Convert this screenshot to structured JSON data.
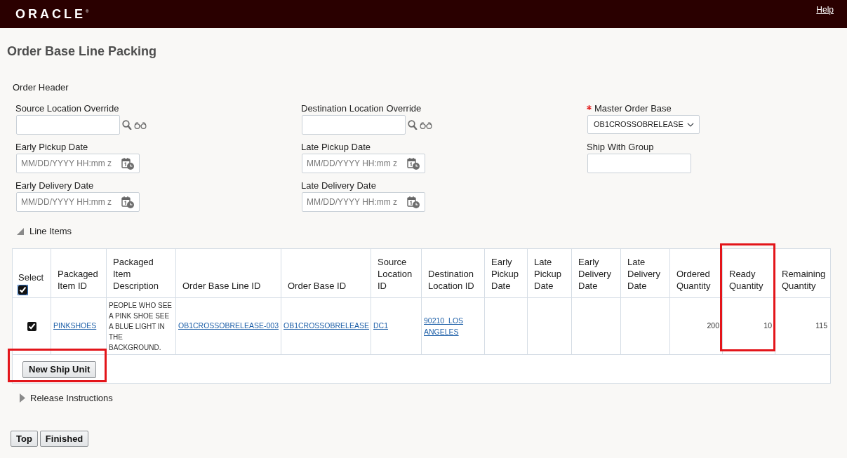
{
  "header": {
    "logo": "ORACLE",
    "logo_mark": "®",
    "help_link": "Help"
  },
  "page_title": "Order Base Line Packing",
  "order_header": {
    "title": "Order Header",
    "columns": [
      {
        "fields": [
          {
            "label": "Source Location Override",
            "kind": "lookup",
            "required": false
          },
          {
            "label": "Early Pickup Date",
            "kind": "date",
            "placeholder": "MM/DD/YYYY HH:mm z",
            "required": false
          },
          {
            "label": "Early Delivery Date",
            "kind": "date",
            "placeholder": "MM/DD/YYYY HH:mm z",
            "required": false
          }
        ]
      },
      {
        "fields": [
          {
            "label": "Destination Location Override",
            "kind": "lookup",
            "required": false
          },
          {
            "label": "Late Pickup Date",
            "kind": "date",
            "placeholder": "MM/DD/YYYY HH:mm z",
            "required": false
          },
          {
            "label": "Late Delivery Date",
            "kind": "date",
            "placeholder": "MM/DD/YYYY HH:mm z",
            "required": false
          }
        ]
      },
      {
        "fields": [
          {
            "label": "Master Order Base",
            "kind": "select",
            "value": "OB1CROSSOBRELEASE",
            "required": true
          },
          {
            "label": "Ship With Group",
            "kind": "text",
            "required": false
          }
        ]
      }
    ]
  },
  "line_items": {
    "title": "Line Items",
    "expanded": true,
    "select_all": {
      "label": "Select",
      "checked": true
    },
    "columns": [
      {
        "label": "Packaged Item ID",
        "highlighted": false
      },
      {
        "label": "Packaged Item Description",
        "highlighted": false
      },
      {
        "label": "Order Base Line ID",
        "highlighted": false
      },
      {
        "label": "Order Base ID",
        "highlighted": false
      },
      {
        "label": "Source Location ID",
        "highlighted": false
      },
      {
        "label": "Destination Location ID",
        "highlighted": false
      },
      {
        "label": "Early Pickup Date",
        "highlighted": false
      },
      {
        "label": "Late Pickup Date",
        "highlighted": false
      },
      {
        "label": "Early Delivery Date",
        "highlighted": false
      },
      {
        "label": "Late Delivery Date",
        "highlighted": false
      },
      {
        "label": "Ordered Quantity",
        "highlighted": false
      },
      {
        "label": "Ready Quantity",
        "highlighted": true
      },
      {
        "label": "Remaining Quantity",
        "highlighted": false
      }
    ],
    "rows": [
      {
        "selected": true,
        "cells": [
          {
            "kind": "link",
            "text": "PINKSHOES"
          },
          {
            "kind": "text",
            "text": "PEOPLE WHO SEE A PINK SHOE SEE A BLUE LIGHT IN THE BACKGROUND."
          },
          {
            "kind": "link",
            "text": "OB1CROSSOBRELEASE-003"
          },
          {
            "kind": "link",
            "text": "OB1CROSSOBRELEASE"
          },
          {
            "kind": "link",
            "text": "DC1"
          },
          {
            "kind": "link",
            "text": "90210_LOS ANGELES"
          },
          {
            "kind": "empty"
          },
          {
            "kind": "empty"
          },
          {
            "kind": "empty"
          },
          {
            "kind": "empty"
          },
          {
            "kind": "number",
            "text": "200"
          },
          {
            "kind": "number",
            "text": "10"
          },
          {
            "kind": "number",
            "text": "115"
          }
        ]
      }
    ],
    "footer_button": {
      "label": "New Ship Unit",
      "highlighted": true
    }
  },
  "release_instructions": {
    "title": "Release Instructions",
    "expanded": false
  },
  "buttons": [
    {
      "label": "Top",
      "highlighted": false
    },
    {
      "label": "Finished",
      "highlighted": false
    }
  ]
}
